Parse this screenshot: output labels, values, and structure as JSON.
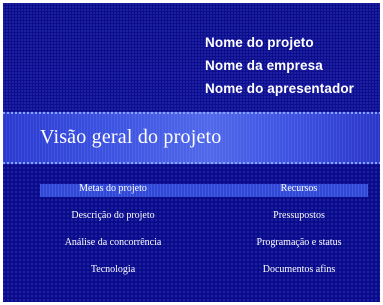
{
  "header": {
    "lines": [
      "Nome do projeto",
      "Nome da empresa",
      "Nome do apresentador"
    ]
  },
  "section_title": "Visão geral do projeto",
  "topics": {
    "left": [
      "Metas do projeto",
      "Descrição do projeto",
      "Análise da concorrência",
      "Tecnologia"
    ],
    "right": [
      "Recursos",
      "Pressupostos",
      "Programação e status",
      "Documentos afins"
    ]
  },
  "colors": {
    "background": "#0b0b8a",
    "band": "#3a50e0",
    "text": "#ffffff"
  }
}
